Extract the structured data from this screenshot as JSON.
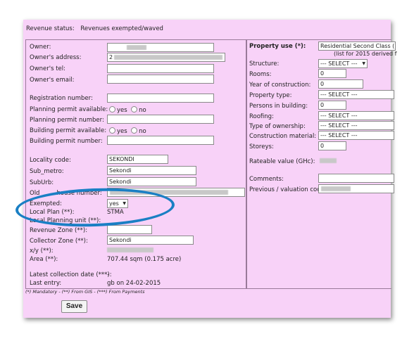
{
  "status": {
    "label": "Revenue status:",
    "value": "Revenues exempted/waved"
  },
  "left": {
    "owner": "Owner:",
    "owner_address": "Owner's address:",
    "owner_address_value": "2",
    "owner_tel": "Owner's tel:",
    "owner_email": "Owner's email:",
    "registration_number": "Registration number:",
    "planning_permit_available": "Planning permit available:",
    "planning_permit_number": "Planning permit number:",
    "building_permit_available": "Building permit available:",
    "building_permit_number": "Building permit number:",
    "yes": "yes",
    "no": "no",
    "locality_code": "Locality code:",
    "locality_code_value": "SEKONDI",
    "sub_metro": "Sub_metro:",
    "sub_metro_value": "Sekondi",
    "suburb": "SubUrb:",
    "suburb_value": "Sekondi",
    "old_house_number_fragment": "Old",
    "old_house_number_fragment2": "house number:",
    "exempted": "Exempted:",
    "exempted_value": "yes",
    "local_plan": "Local Plan (**):",
    "local_plan_value": "STMA",
    "local_planning_unit": "Local Planning unit (**):",
    "revenue_zone": "Revenue Zone (**):",
    "collector_zone": "Collector Zone (**):",
    "collector_zone_value": "Sekondi",
    "xy": "x/y (**):",
    "area": "Area (**):",
    "area_value": "707.44 sqm (0.175 acre)",
    "latest_collection_date": "Latest collection date (***):",
    "latest_collection_date_value": "-",
    "last_entry": "Last entry:",
    "last_entry_value": "gb on 24-02-2015"
  },
  "right": {
    "property_use": "Property use (*):",
    "property_use_value": "Residential Second Class (",
    "property_use_note": "(list for 2015 derived f",
    "structure": "Structure:",
    "structure_value": "--- SELECT ---",
    "rooms": "Rooms:",
    "rooms_value": "0",
    "year_of_construction": "Year of construction:",
    "year_of_construction_value": "0",
    "property_type": "Property type:",
    "property_type_value": "--- SELECT ---",
    "persons_in_building": "Persons in building:",
    "persons_in_building_value": "0",
    "roofing": "Roofing:",
    "roofing_value": "--- SELECT ---",
    "type_of_ownership": "Type of ownership:",
    "type_of_ownership_value": "--- SELECT ---",
    "construction_material": "Construction material:",
    "construction_material_value": "--- SELECT ---",
    "storeys": "Storeys:",
    "storeys_value": "0",
    "rateable_value": "Rateable value (GHc):",
    "comments": "Comments:",
    "previous_valuation_code": "Previous / valuation code:"
  },
  "footnote": "(*) Mandatory - (**) From GIS - (***) From Payments",
  "save_label": "Save"
}
